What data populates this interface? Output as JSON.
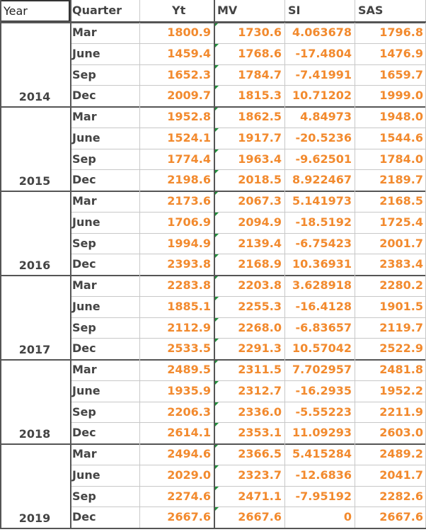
{
  "headers": {
    "year": "Year",
    "quarter": "Quarter",
    "yt": "Yt",
    "mv": "MV",
    "si": "SI",
    "sas": "SAS"
  },
  "groups": [
    {
      "year": "2014",
      "rows": [
        {
          "quarter": "Mar",
          "yt": "1800.9",
          "mv": "1730.6",
          "si": "4.063678",
          "sas": "1796.8"
        },
        {
          "quarter": "June",
          "yt": "1459.4",
          "mv": "1768.6",
          "si": "-17.4804",
          "sas": "1476.9"
        },
        {
          "quarter": "Sep",
          "yt": "1652.3",
          "mv": "1784.7",
          "si": "-7.41991",
          "sas": "1659.7"
        },
        {
          "quarter": "Dec",
          "yt": "2009.7",
          "mv": "1815.3",
          "si": "10.71202",
          "sas": "1999.0"
        }
      ]
    },
    {
      "year": "2015",
      "rows": [
        {
          "quarter": "Mar",
          "yt": "1952.8",
          "mv": "1862.5",
          "si": "4.84973",
          "sas": "1948.0"
        },
        {
          "quarter": "June",
          "yt": "1524.1",
          "mv": "1917.7",
          "si": "-20.5236",
          "sas": "1544.6"
        },
        {
          "quarter": "Sep",
          "yt": "1774.4",
          "mv": "1963.4",
          "si": "-9.62501",
          "sas": "1784.0"
        },
        {
          "quarter": "Dec",
          "yt": "2198.6",
          "mv": "2018.5",
          "si": "8.922467",
          "sas": "2189.7"
        }
      ]
    },
    {
      "year": "2016",
      "rows": [
        {
          "quarter": "Mar",
          "yt": "2173.6",
          "mv": "2067.3",
          "si": "5.141973",
          "sas": "2168.5"
        },
        {
          "quarter": "June",
          "yt": "1706.9",
          "mv": "2094.9",
          "si": "-18.5192",
          "sas": "1725.4"
        },
        {
          "quarter": "Sep",
          "yt": "1994.9",
          "mv": "2139.4",
          "si": "-6.75423",
          "sas": "2001.7"
        },
        {
          "quarter": "Dec",
          "yt": "2393.8",
          "mv": "2168.9",
          "si": "10.36931",
          "sas": "2383.4"
        }
      ]
    },
    {
      "year": "2017",
      "rows": [
        {
          "quarter": "Mar",
          "yt": "2283.8",
          "mv": "2203.8",
          "si": "3.628918",
          "sas": "2280.2"
        },
        {
          "quarter": "June",
          "yt": "1885.1",
          "mv": "2255.3",
          "si": "-16.4128",
          "sas": "1901.5"
        },
        {
          "quarter": "Sep",
          "yt": "2112.9",
          "mv": "2268.0",
          "si": "-6.83657",
          "sas": "2119.7"
        },
        {
          "quarter": "Dec",
          "yt": "2533.5",
          "mv": "2291.3",
          "si": "10.57042",
          "sas": "2522.9"
        }
      ]
    },
    {
      "year": "2018",
      "rows": [
        {
          "quarter": "Mar",
          "yt": "2489.5",
          "mv": "2311.5",
          "si": "7.702957",
          "sas": "2481.8"
        },
        {
          "quarter": "June",
          "yt": "1935.9",
          "mv": "2312.7",
          "si": "-16.2935",
          "sas": "1952.2"
        },
        {
          "quarter": "Sep",
          "yt": "2206.3",
          "mv": "2336.0",
          "si": "-5.55223",
          "sas": "2211.9"
        },
        {
          "quarter": "Dec",
          "yt": "2614.1",
          "mv": "2353.1",
          "si": "11.09293",
          "sas": "2603.0"
        }
      ]
    },
    {
      "year": "2019",
      "rows": [
        {
          "quarter": "Mar",
          "yt": "2494.6",
          "mv": "2366.5",
          "si": "5.415284",
          "sas": "2489.2"
        },
        {
          "quarter": "June",
          "yt": "2029.0",
          "mv": "2323.7",
          "si": "-12.6836",
          "sas": "2041.7"
        },
        {
          "quarter": "Sep",
          "yt": "2274.6",
          "mv": "2471.1",
          "si": "-7.95192",
          "sas": "2282.6"
        },
        {
          "quarter": "Dec",
          "yt": "2667.6",
          "mv": "2667.6",
          "si": "0",
          "sas": "2667.6"
        }
      ]
    }
  ],
  "colors": {
    "value_text": "#f28a2e",
    "label_text": "#444444",
    "formula_marker": "#1f8f3a"
  }
}
